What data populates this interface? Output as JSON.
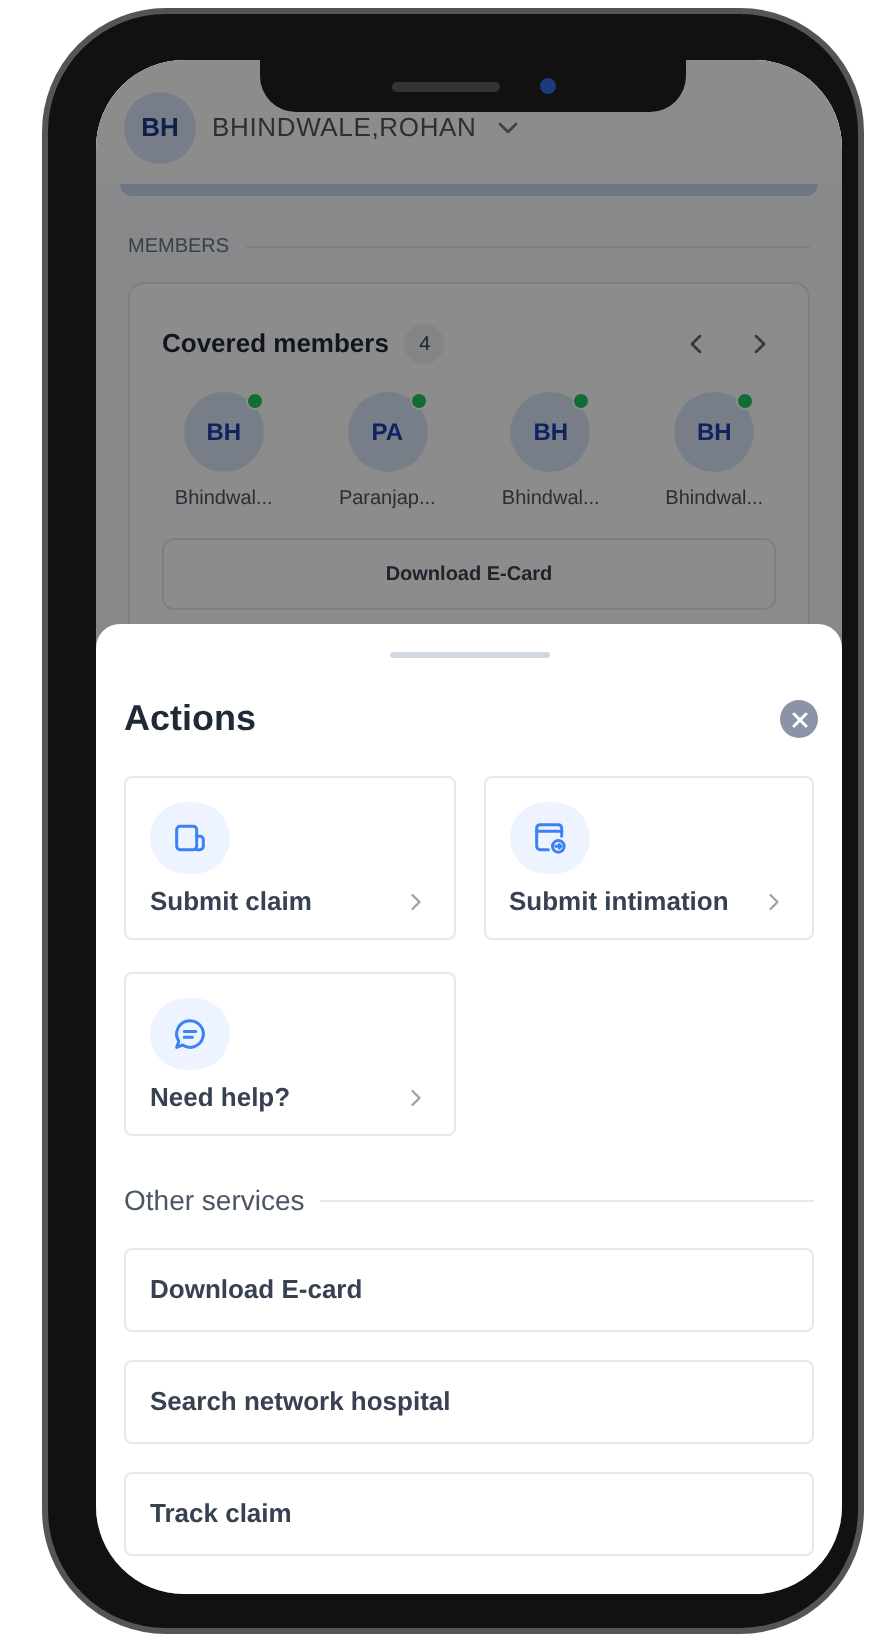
{
  "header": {
    "initials": "BH",
    "name": "BHINDWALE,ROHAN"
  },
  "members": {
    "section_label": "MEMBERS",
    "title": "Covered members",
    "count": "4",
    "items": [
      {
        "initials": "BH",
        "name": "Bhindwal..."
      },
      {
        "initials": "PA",
        "name": "Paranjap..."
      },
      {
        "initials": "BH",
        "name": "Bhindwal..."
      },
      {
        "initials": "BH",
        "name": "Bhindwal..."
      }
    ],
    "button": "Download E-Card"
  },
  "sheet": {
    "title": "Actions",
    "actions": [
      {
        "kind": "claim",
        "label": "Submit claim"
      },
      {
        "kind": "intimation",
        "label": "Submit intimation"
      },
      {
        "kind": "help",
        "label": "Need help?"
      }
    ],
    "other_label": "Other services",
    "services": [
      "Download E-card",
      "Search network hospital",
      "Track claim"
    ]
  }
}
